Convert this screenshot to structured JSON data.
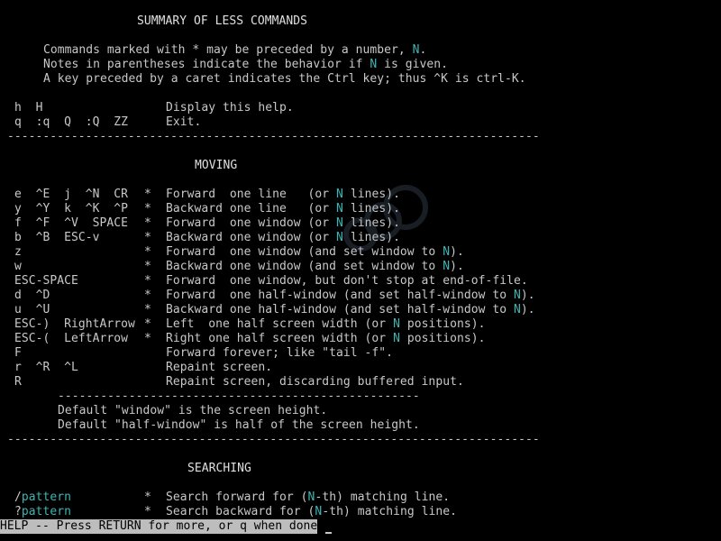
{
  "title": "SUMMARY OF LESS COMMANDS",
  "intro": [
    {
      "pre": "Commands marked with * may be preceded by a number, ",
      "hl": "N",
      "post": "."
    },
    {
      "pre": "Notes in parentheses indicate the behavior if ",
      "hl": "N",
      "post": " is given."
    },
    {
      "pre": "A key preceded by a caret indicates the Ctrl key; thus ^K is ctrl-K.",
      "hl": "",
      "post": ""
    }
  ],
  "help_rows": [
    {
      "keys": "h  H",
      "star": "",
      "desc": "Display this help."
    },
    {
      "keys": "q  :q  Q  :Q  ZZ",
      "star": "",
      "desc": "Exit."
    }
  ],
  "rule_full": "---------------------------------------------------------------------------",
  "rule_short": "---------------------------------------------------",
  "moving_heading": "MOVING",
  "moving_rows": [
    {
      "keys": "e  ^E  j  ^N  CR",
      "star": "*",
      "d1": "Forward  one line   (or ",
      "hl": "N",
      "d2": " lines)."
    },
    {
      "keys": "y  ^Y  k  ^K  ^P",
      "star": "*",
      "d1": "Backward one line   (or ",
      "hl": "N",
      "d2": " lines)."
    },
    {
      "keys": "f  ^F  ^V  SPACE",
      "star": "*",
      "d1": "Forward  one window (or ",
      "hl": "N",
      "d2": " lines)."
    },
    {
      "keys": "b  ^B  ESC-v",
      "star": "*",
      "d1": "Backward one window (or ",
      "hl": "N",
      "d2": " lines)."
    },
    {
      "keys": "z",
      "star": "*",
      "d1": "Forward  one window (and set window to ",
      "hl": "N",
      "d2": ")."
    },
    {
      "keys": "w",
      "star": "*",
      "d1": "Backward one window (and set window to ",
      "hl": "N",
      "d2": ")."
    },
    {
      "keys": "ESC-SPACE",
      "star": "*",
      "d1": "Forward  one window, but don't stop at end-of-file.",
      "hl": "",
      "d2": ""
    },
    {
      "keys": "d  ^D",
      "star": "*",
      "d1": "Forward  one half-window (and set half-window to ",
      "hl": "N",
      "d2": ")."
    },
    {
      "keys": "u  ^U",
      "star": "*",
      "d1": "Backward one half-window (and set half-window to ",
      "hl": "N",
      "d2": ")."
    },
    {
      "keys": "ESC-)  RightArrow",
      "star": "*",
      "d1": "Left  one half screen width (or ",
      "hl": "N",
      "d2": " positions)."
    },
    {
      "keys": "ESC-(  LeftArrow",
      "star": "*",
      "d1": "Right one half screen width (or ",
      "hl": "N",
      "d2": " positions)."
    },
    {
      "keys": "F",
      "star": "",
      "d1": "Forward forever; like \"tail -f\".",
      "hl": "",
      "d2": ""
    },
    {
      "keys": "r  ^R  ^L",
      "star": "",
      "d1": "Repaint screen.",
      "hl": "",
      "d2": ""
    },
    {
      "keys": "R",
      "star": "",
      "d1": "Repaint screen, discarding buffered input.",
      "hl": "",
      "d2": ""
    }
  ],
  "defaults": [
    "Default \"window\" is the screen height.",
    "Default \"half-window\" is half of the screen height."
  ],
  "searching_heading": "SEARCHING",
  "searching_rows": [
    {
      "prefix": "/",
      "pattern": "pattern",
      "star": "*",
      "d1": "Search forward for (",
      "hl": "N",
      "d2": "-th) matching line."
    },
    {
      "prefix": "?",
      "pattern": "pattern",
      "star": "*",
      "d1": "Search backward for (",
      "hl": "N",
      "d2": "-th) matching line."
    }
  ],
  "status_bar": "HELP -- Press RETURN for more, or q when done",
  "colors": {
    "background": "#000000",
    "text": "#c8c8c8",
    "highlight": "#3fb4b4",
    "status_bg": "#bdbdbd"
  }
}
